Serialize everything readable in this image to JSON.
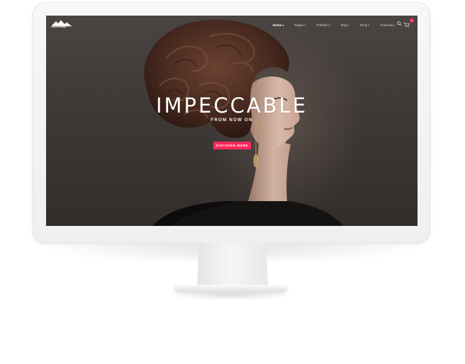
{
  "site": {
    "logo_text": "CALIFORNIA"
  },
  "nav": {
    "items": [
      {
        "label": "Home",
        "active": true
      },
      {
        "label": "Pages",
        "active": false
      },
      {
        "label": "Portfolio",
        "active": false
      },
      {
        "label": "Blog",
        "active": false
      },
      {
        "label": "Shop",
        "active": false
      },
      {
        "label": "Features",
        "active": false
      }
    ],
    "caret": "▾",
    "cart_count": "0"
  },
  "hero": {
    "title": "IMPECCABLE",
    "subtitle": "FROM NOW ON",
    "button_label": "DISCOVER MORE"
  },
  "colors": {
    "accent": "#ff2a5c",
    "hero_bg": "#3d3735",
    "monitor": "#f0f0f0"
  },
  "icons": [
    "mountain-logo-icon",
    "search-icon",
    "cart-icon"
  ]
}
